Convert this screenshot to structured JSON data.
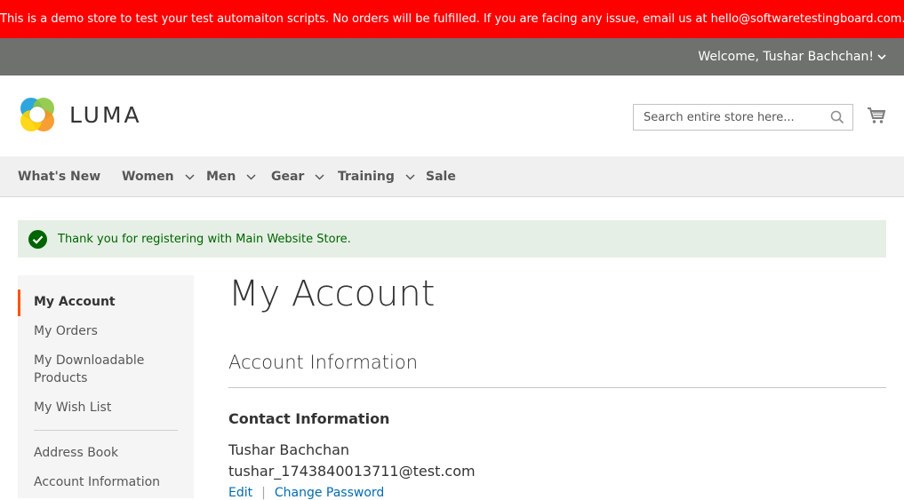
{
  "demo_notice": "This is a demo store to test your test automaiton scripts. No orders will be fulfilled. If you are facing any issue, email us at hello@softwaretestingboard.com.",
  "header": {
    "welcome": "Welcome, Tushar Bachchan!",
    "logo_text": "LUMA",
    "search_placeholder": "Search entire store here..."
  },
  "nav": {
    "items": [
      {
        "label": "What's New"
      },
      {
        "label": "Women"
      },
      {
        "label": "Men"
      },
      {
        "label": "Gear"
      },
      {
        "label": "Training"
      },
      {
        "label": "Sale"
      }
    ]
  },
  "message": "Thank you for registering with Main Website Store.",
  "sidebar": {
    "items": [
      {
        "label": "My Account"
      },
      {
        "label": "My Orders"
      },
      {
        "label": "My Downloadable Products"
      },
      {
        "label": "My Wish List"
      },
      {
        "label": "Address Book"
      },
      {
        "label": "Account Information"
      }
    ]
  },
  "main": {
    "title": "My Account",
    "section_title": "Account Information",
    "contact": {
      "title": "Contact Information",
      "name": "Tushar Bachchan",
      "email": "tushar_1743840013711@test.com",
      "edit_label": "Edit",
      "separator": "|",
      "change_password_label": "Change Password"
    }
  },
  "colors": {
    "demo_bar": "#ff0000",
    "header_bar": "#6e716e",
    "accent": "#ff5501",
    "link": "#006bb4",
    "success_bg": "#e5efe5",
    "success_text": "#006400"
  }
}
